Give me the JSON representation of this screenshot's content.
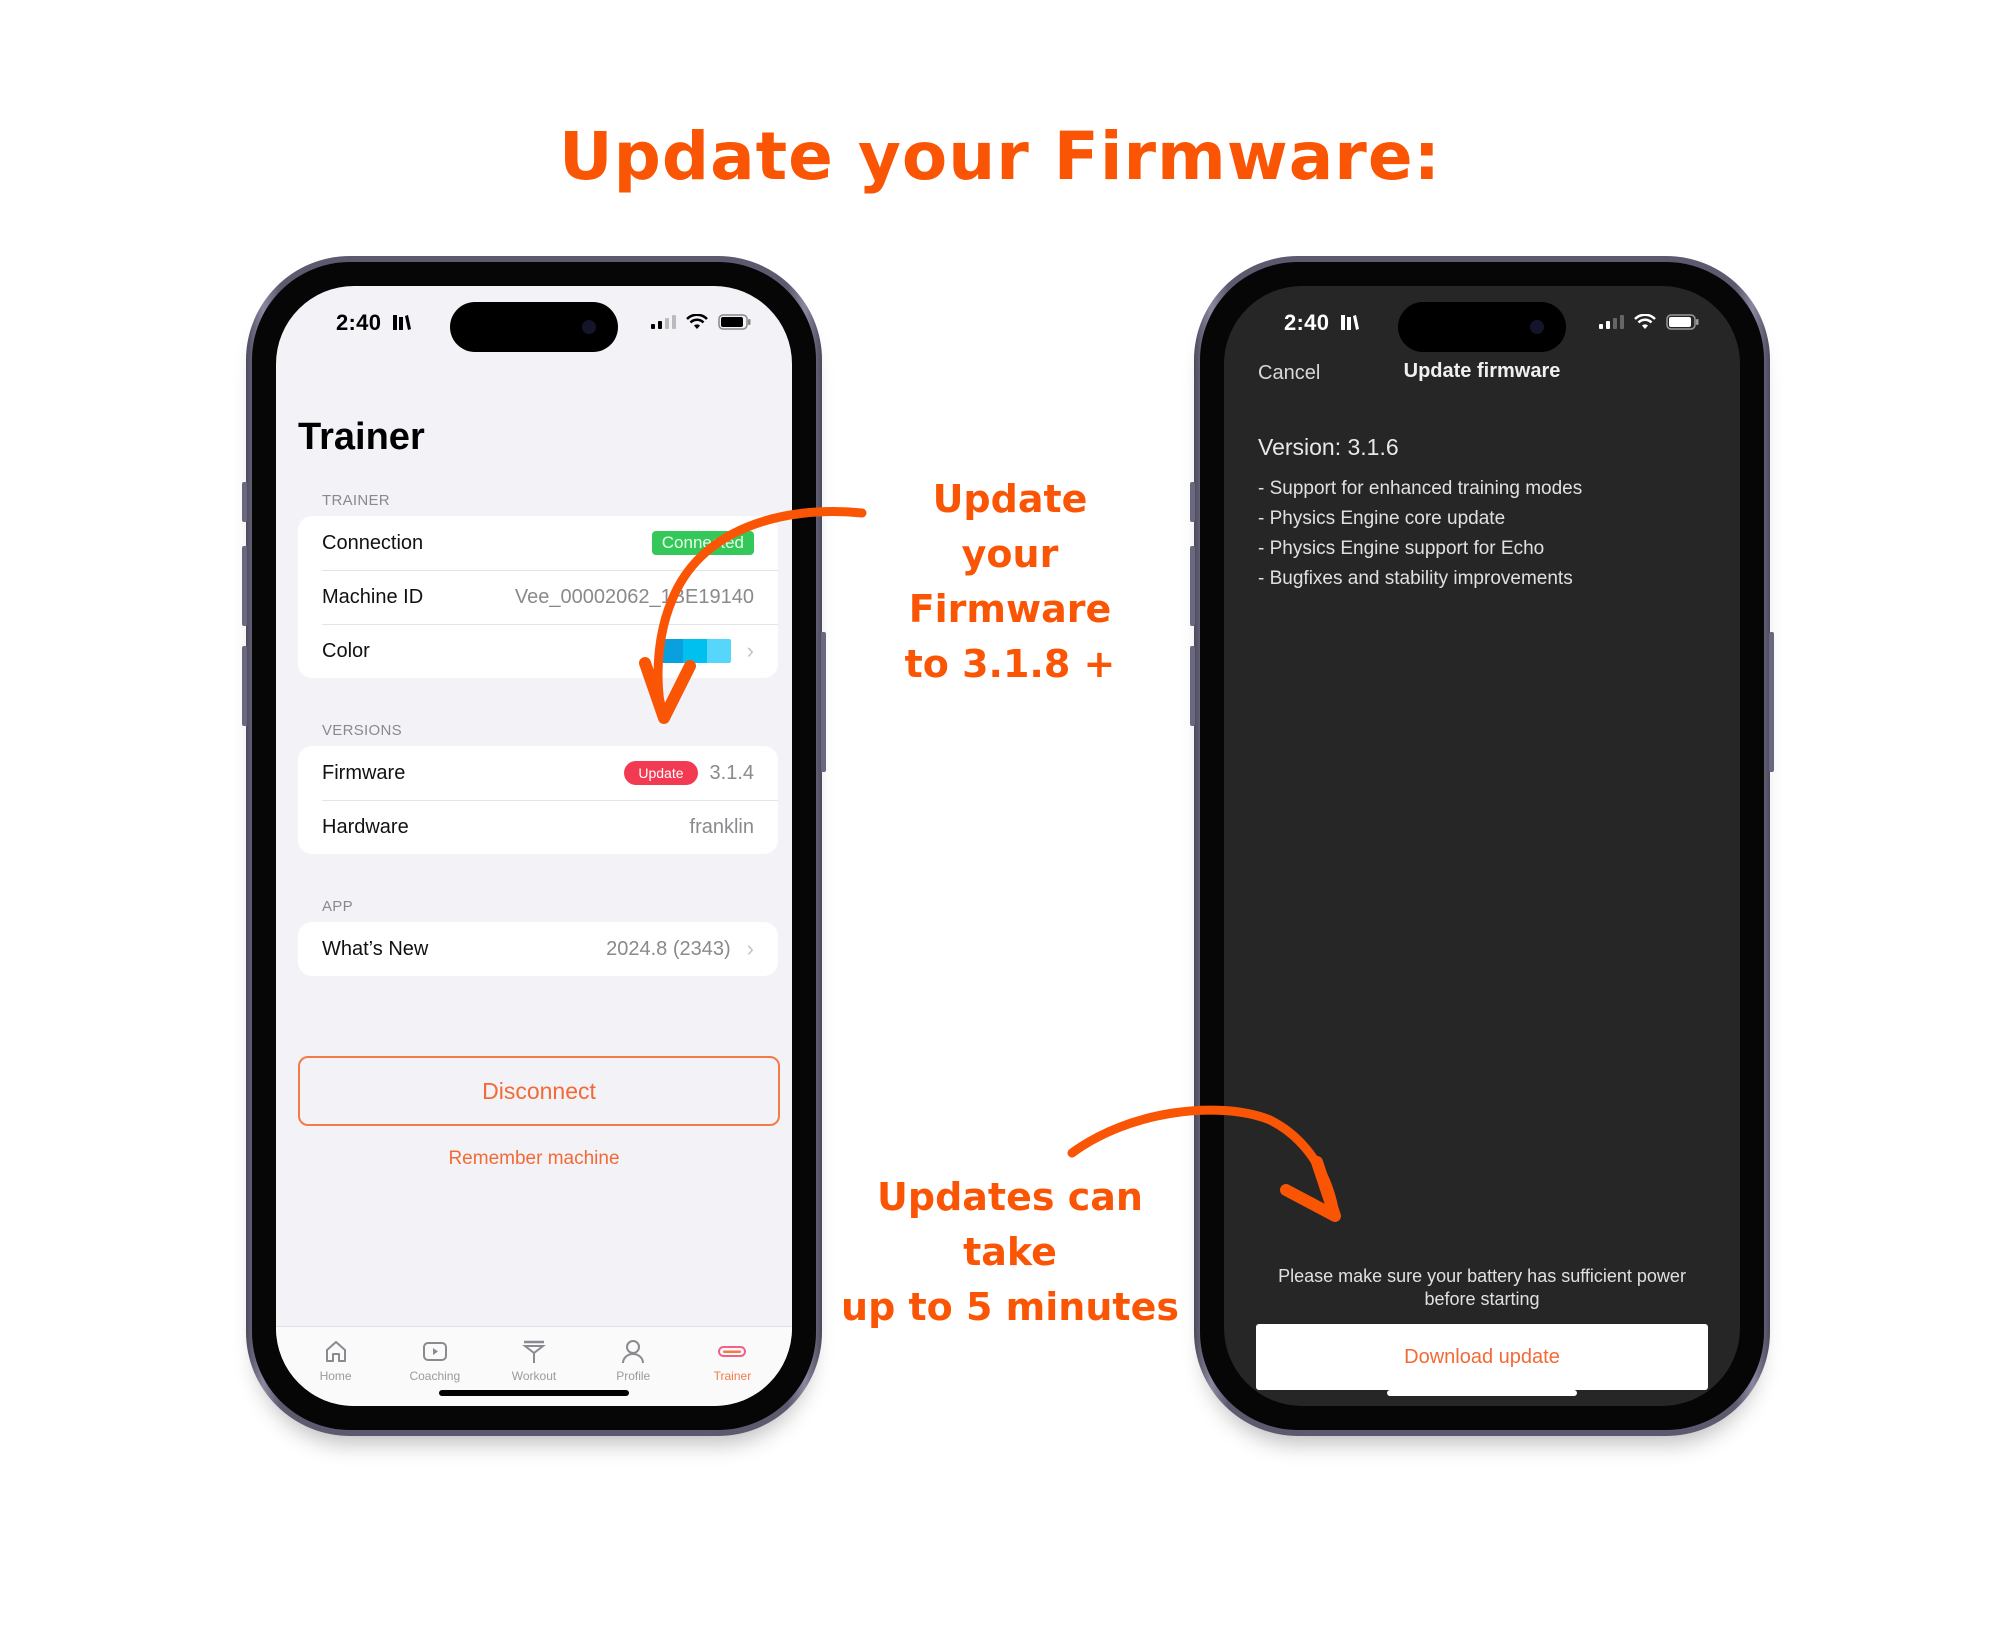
{
  "headline": "Update your Firmware:",
  "colors": {
    "accent_orange": "#fa5505",
    "app_orange": "#f26a36",
    "connected_green": "#34c759",
    "update_red": "#f23a52",
    "trainer_colors": [
      "#0aa0e0",
      "#00c0f0",
      "#55d6fa"
    ]
  },
  "left_phone": {
    "status_bar": {
      "time": "2:40",
      "time_icon": "library-books-icon",
      "icons": [
        "cellular-signal-icon",
        "wifi-icon",
        "battery-icon"
      ]
    },
    "title": "Trainer",
    "sections": {
      "trainer": {
        "label": "TRAINER",
        "rows": [
          {
            "label": "Connection",
            "badge": "Connected"
          },
          {
            "label": "Machine ID",
            "value": "Vee_00002062_1BE19140"
          },
          {
            "label": "Color",
            "swatch_icon": "color-swatch",
            "chevron": "chevron-right-icon"
          }
        ]
      },
      "versions": {
        "label": "VERSIONS",
        "rows": [
          {
            "label": "Firmware",
            "badge": "Update",
            "value": "3.1.4"
          },
          {
            "label": "Hardware",
            "value": "franklin"
          }
        ]
      },
      "app": {
        "label": "APP",
        "rows": [
          {
            "label": "What’s New",
            "value": "2024.8 (2343)",
            "chevron": "chevron-right-icon"
          }
        ]
      }
    },
    "disconnect_label": "Disconnect",
    "remember_label": "Remember machine",
    "tabs": [
      {
        "label": "Home",
        "icon": "home-icon",
        "active": false
      },
      {
        "label": "Coaching",
        "icon": "play-icon",
        "active": false
      },
      {
        "label": "Workout",
        "icon": "workout-icon",
        "active": false
      },
      {
        "label": "Profile",
        "icon": "profile-icon",
        "active": false
      },
      {
        "label": "Trainer",
        "icon": "trainer-icon",
        "active": true
      }
    ]
  },
  "right_phone": {
    "status_bar": {
      "time": "2:40",
      "time_icon": "library-books-icon",
      "icons": [
        "cellular-signal-icon",
        "wifi-icon",
        "battery-icon"
      ]
    },
    "nav": {
      "cancel": "Cancel",
      "title": "Update firmware"
    },
    "version_title": "Version: 3.1.6",
    "release_notes": [
      "- Support for enhanced training modes",
      "- Physics Engine core update",
      "- Physics Engine support for Echo",
      "- Bugfixes and stability improvements"
    ],
    "battery_note": "Please make sure your battery has sufficient power before starting",
    "download_label": "Download update"
  },
  "annotations": {
    "update_callout": [
      "Update your",
      "Firmware",
      "to 3.1.8 +"
    ],
    "time_callout": [
      "Updates can take",
      "up to 5 minutes"
    ]
  }
}
